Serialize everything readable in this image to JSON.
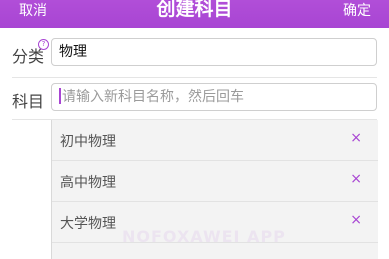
{
  "header": {
    "cancel_label": "取消",
    "title": "创建科目",
    "confirm_label": "确定",
    "bar_color": "#a845d3"
  },
  "form": {
    "category_label": "分类",
    "category_help_icon": "question-icon",
    "category_value": "物理",
    "subject_label": "科目",
    "subject_placeholder": "请输入新科目名称，然后回车"
  },
  "subjects": [
    {
      "name": "初中物理",
      "remove_icon": "close-icon"
    },
    {
      "name": "高中物理",
      "remove_icon": "close-icon"
    },
    {
      "name": "大学物理",
      "remove_icon": "close-icon"
    }
  ],
  "watermark": "NOFOXAWEI APP"
}
